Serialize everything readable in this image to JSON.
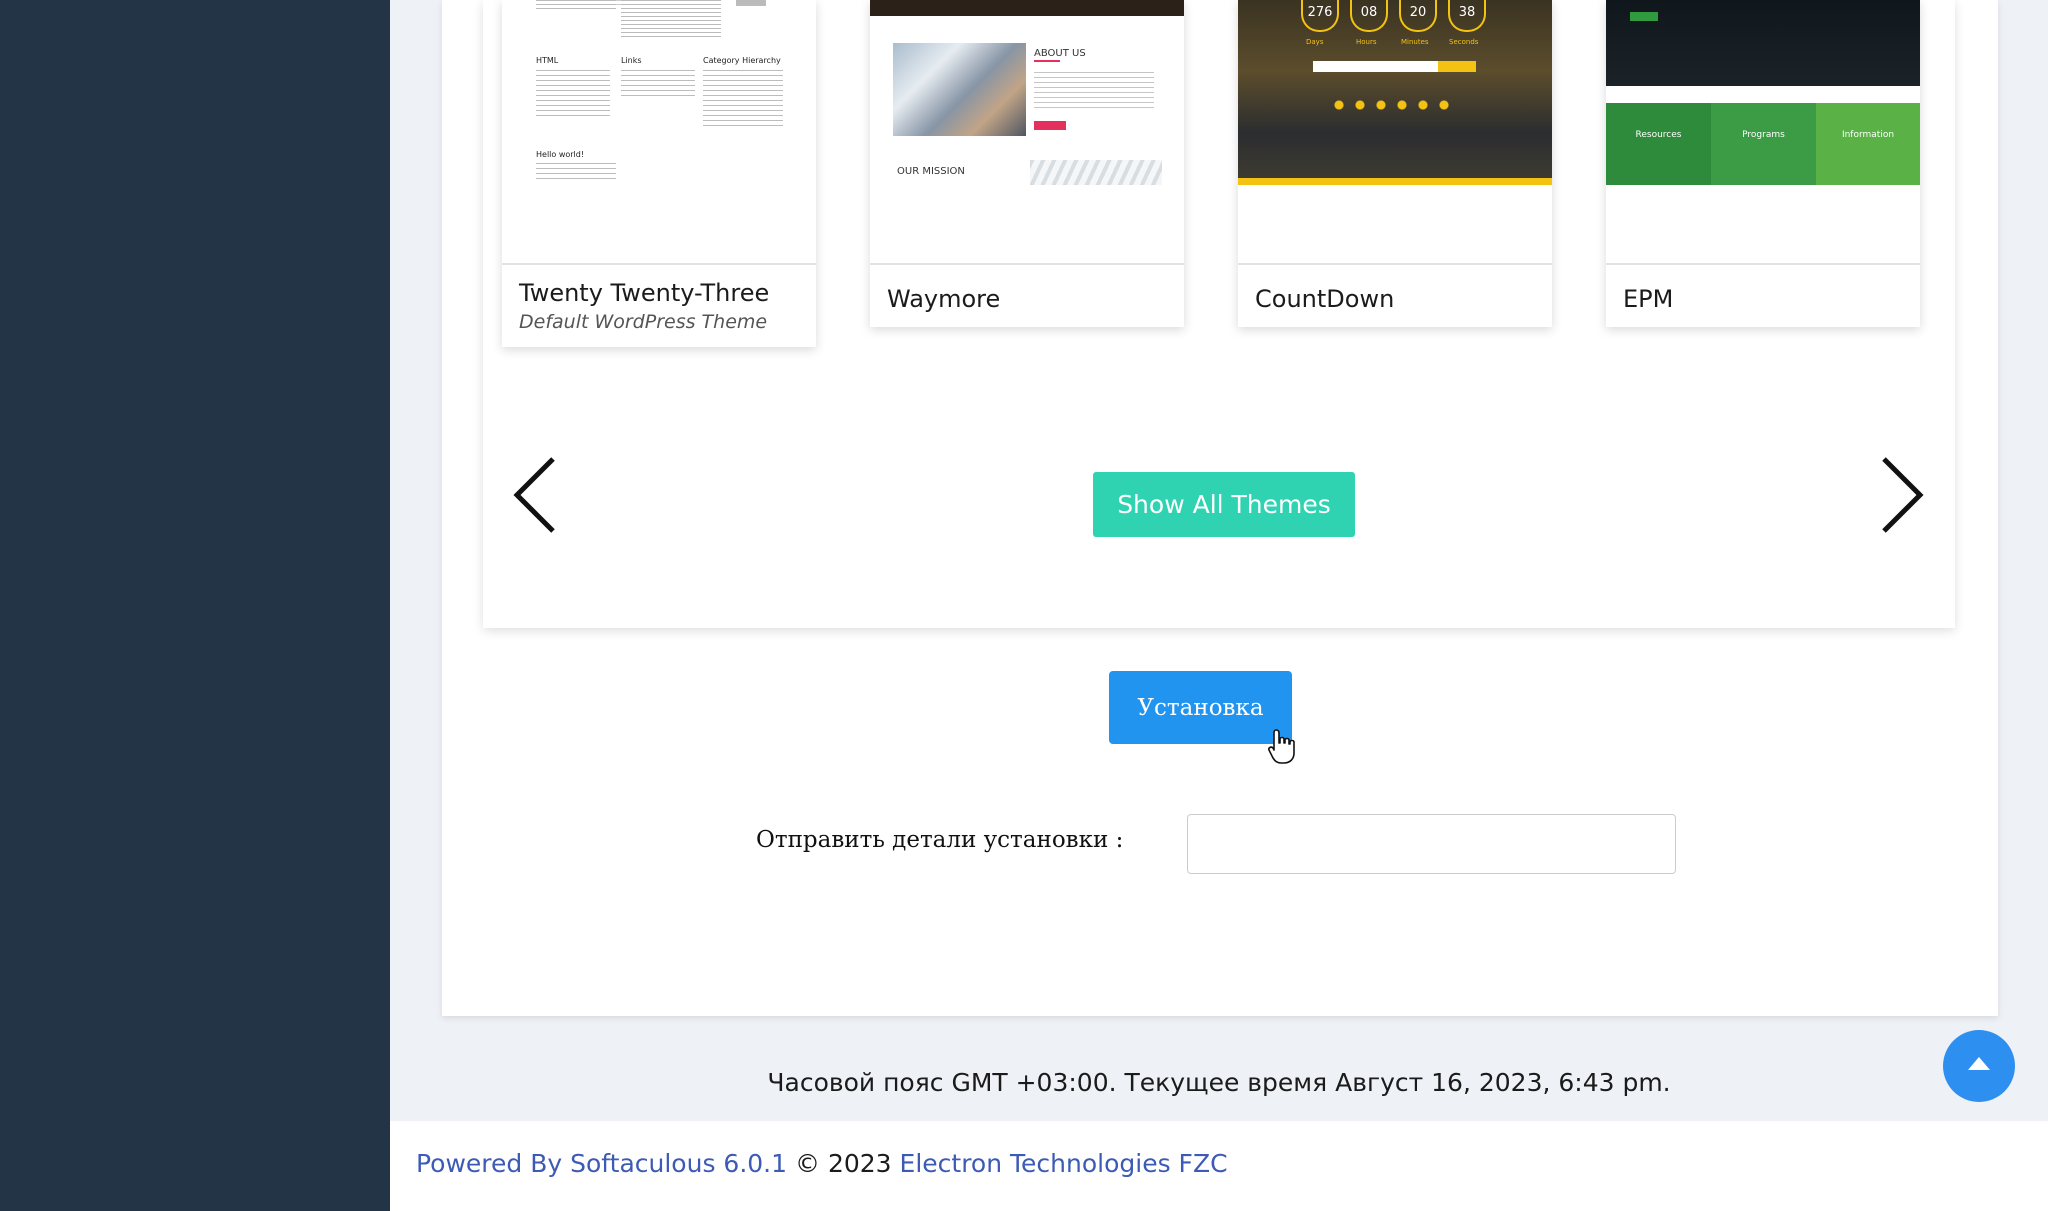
{
  "themes": [
    {
      "name": "Twenty Twenty-Three",
      "subtitle": "Default WordPress Theme"
    },
    {
      "name": "Waymore",
      "subtitle": ""
    },
    {
      "name": "CountDown",
      "subtitle": ""
    },
    {
      "name": "EPM",
      "subtitle": ""
    }
  ],
  "thumbs": {
    "t1": {
      "col_headers": [
        "HTML",
        "Links",
        "Category Hierarchy"
      ],
      "post_title": "Hello world!"
    },
    "waymore": {
      "about": "ABOUT US",
      "mission": "OUR MISSION"
    },
    "countdown": {
      "numbers": [
        "276",
        "08",
        "20",
        "38"
      ],
      "units": [
        "Days",
        "Hours",
        "Minutes",
        "Seconds"
      ]
    },
    "epm": {
      "tiles": [
        "Resources",
        "Programs",
        "Information"
      ]
    }
  },
  "carousel": {
    "show_all_label": "Show All Themes"
  },
  "install": {
    "button_label": "Установка",
    "email_label": "Отправить детали установки :",
    "email_value": ""
  },
  "timezone_text": "Часовой пояс GMT +03:00. Текущее время Август 16, 2023, 6:43 pm.",
  "footer": {
    "powered_by": "Powered By Softaculous 6.0.1",
    "copyright": "© 2023",
    "company": "Electron Technologies FZC"
  },
  "colors": {
    "sidebar": "#243447",
    "teal_button": "#2fd3b1",
    "install_button": "#2194f0",
    "link": "#3d5bb5"
  }
}
